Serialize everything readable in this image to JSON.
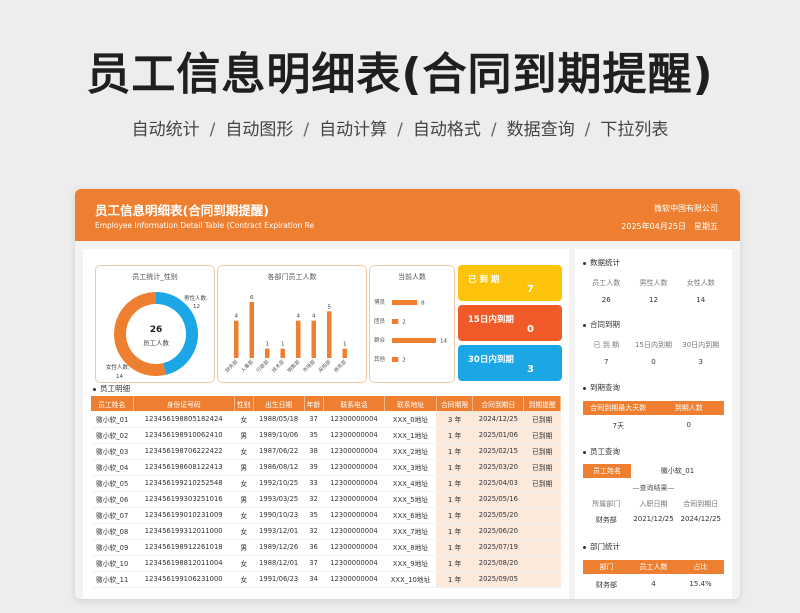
{
  "promo": {
    "title": "员工信息明细表(合同到期提醒)",
    "features": [
      "自动统计",
      "自动图形",
      "自动计算",
      "自动格式",
      "数据查询",
      "下拉列表"
    ]
  },
  "header": {
    "title": "员工信息明细表(合同到期提醒)",
    "subtitle": "Employee Information Detail Table (Contract Expiration Re",
    "company": "微软中国有限公司",
    "date": "2025年04月25日",
    "weekday": "星期五"
  },
  "colors": {
    "accent": "#ef7f30",
    "yellow": "#fcc30a",
    "red": "#f05a28",
    "blue": "#1ba6e6"
  },
  "donut": {
    "title": "员工统计_性别",
    "center_value": "26",
    "center_label": "员工人数",
    "male_label": "男性人数,",
    "male_value": "12",
    "female_label": "女性人数,",
    "female_value": "14",
    "male": 12,
    "female": 14
  },
  "dept_chart": {
    "title": "各部门员工人数",
    "categories": [
      "财务部",
      "人事部",
      "行政部",
      "技术部",
      "销售部",
      "市场部",
      "采购部",
      "商务部"
    ],
    "values": [
      4,
      6,
      1,
      1,
      4,
      4,
      5,
      1
    ],
    "value_labels": [
      "4",
      "6",
      "1",
      "1",
      "4",
      "4",
      "5",
      "1"
    ]
  },
  "edu_chart": {
    "title": "当前人数",
    "categories": [
      "博员",
      "团员",
      "群众",
      "其他"
    ],
    "values": [
      8,
      2,
      14,
      2
    ],
    "value_labels": [
      "8",
      "2",
      "14",
      "2"
    ]
  },
  "stats": [
    {
      "label": "已 到 期",
      "value": "7"
    },
    {
      "label": "15日内到期",
      "value": "0"
    },
    {
      "label": "30日内到期",
      "value": "3"
    }
  ],
  "table": {
    "section": "员工明细",
    "headers": [
      "员工姓名",
      "身份证号码",
      "性别",
      "出生日期",
      "年龄",
      "联系电话",
      "联系地址",
      "合同期限",
      "合同到期日",
      "到期提醒"
    ],
    "rows": [
      [
        "微小软_01",
        "123456198805182424",
        "女",
        "1988/05/18",
        "37",
        "12300000004",
        "XXX_0地址",
        "3 年",
        "2024/12/25",
        "已到期"
      ],
      [
        "微小软_02",
        "123456198910062410",
        "男",
        "1989/10/06",
        "35",
        "12300000004",
        "XXX_1地址",
        "1 年",
        "2025/01/06",
        "已到期"
      ],
      [
        "微小软_03",
        "123456198706222422",
        "女",
        "1987/06/22",
        "38",
        "12300000004",
        "XXX_2地址",
        "1 年",
        "2025/02/15",
        "已到期"
      ],
      [
        "微小软_04",
        "123456198608122413",
        "男",
        "1986/08/12",
        "39",
        "12300000004",
        "XXX_3地址",
        "1 年",
        "2025/03/20",
        "已到期"
      ],
      [
        "微小软_05",
        "123456199210252548",
        "女",
        "1992/10/25",
        "33",
        "12300000004",
        "XXX_4地址",
        "1 年",
        "2025/04/03",
        "已到期"
      ],
      [
        "微小软_06",
        "123456199303251016",
        "男",
        "1993/03/25",
        "32",
        "12300000004",
        "XXX_5地址",
        "1 年",
        "2025/05/16",
        ""
      ],
      [
        "微小软_07",
        "123456199010231009",
        "女",
        "1990/10/23",
        "35",
        "12300000004",
        "XXX_6地址",
        "1 年",
        "2025/05/20",
        ""
      ],
      [
        "微小软_08",
        "123456199312011000",
        "女",
        "1993/12/01",
        "32",
        "12300000004",
        "XXX_7地址",
        "1 年",
        "2025/06/20",
        ""
      ],
      [
        "微小软_09",
        "123456198912261018",
        "男",
        "1989/12/26",
        "36",
        "12300000004",
        "XXX_8地址",
        "1 年",
        "2025/07/19",
        ""
      ],
      [
        "微小软_10",
        "123456198812011004",
        "女",
        "1988/12/01",
        "37",
        "12300000004",
        "XXX_9地址",
        "1 年",
        "2025/08/20",
        ""
      ],
      [
        "微小软_11",
        "123456199106231000",
        "女",
        "1991/06/23",
        "34",
        "12300000004",
        "XXX_10地址",
        "1 年",
        "2025/09/05",
        ""
      ]
    ]
  },
  "right": {
    "data_stats": {
      "title": "数据统计",
      "labels": [
        "员工人数",
        "男性人数",
        "女性人数"
      ],
      "values": [
        "26",
        "12",
        "14"
      ]
    },
    "contract": {
      "title": "合同到期",
      "labels": [
        "已 到 期",
        "15日内到期",
        "30日内到期"
      ],
      "values": [
        "7",
        "0",
        "3"
      ]
    },
    "expiry_query": {
      "title": "到期查询",
      "headers": [
        "合同到期最大天数",
        "到期人数"
      ],
      "values": [
        "7天",
        "0"
      ]
    },
    "emp_query": {
      "title": "员工查询",
      "name_label": "员工姓名",
      "name_value": "微小软_01",
      "result_label": "—查询结果—",
      "headers": [
        "所属部门",
        "入职日期",
        "合同到期日"
      ],
      "values": [
        "财务部",
        "2021/12/25",
        "2024/12/25"
      ]
    },
    "dept_stats": {
      "title": "部门统计",
      "headers": [
        "部门",
        "员工人数",
        "占比"
      ],
      "values": [
        "财务部",
        "4",
        "15.4%"
      ]
    }
  }
}
